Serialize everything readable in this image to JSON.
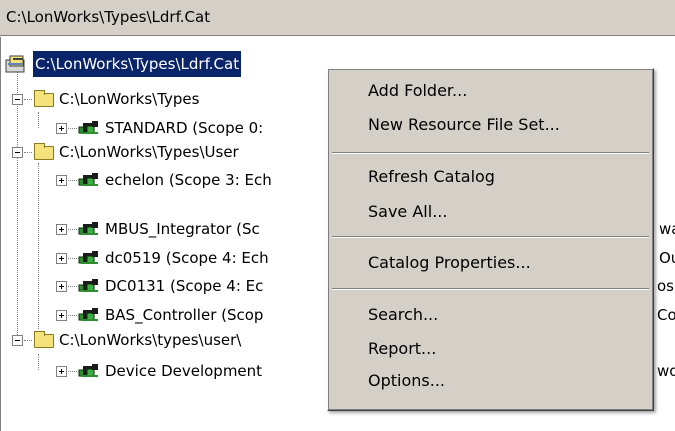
{
  "window": {
    "title": "C:\\LonWorks\\Types\\Ldrf.Cat"
  },
  "tree": {
    "root_label": "C:\\LonWorks\\Types\\Ldrf.Cat",
    "nodes": [
      {
        "label": "C:\\LonWorks\\Types"
      },
      {
        "label": "STANDARD (Scope 0:"
      },
      {
        "label": "C:\\LonWorks\\Types\\User"
      },
      {
        "label": "echelon (Scope 3: Ech"
      },
      {
        "label": "MBUS_Integrator (Sc"
      },
      {
        "label": "dc0519 (Scope 4: Ech"
      },
      {
        "label": "DC0131 (Scope 4: Ec"
      },
      {
        "label": "BAS_Controller (Scop"
      },
      {
        "label": "C:\\LonWorks\\types\\user\\"
      },
      {
        "label": "Device Development"
      }
    ],
    "clipped_right": [
      "wa",
      "Ou",
      "osh",
      "Co",
      "wor"
    ]
  },
  "context_menu": {
    "add_folder": "Add Folder...",
    "new_resource_file_set": "New Resource File Set...",
    "refresh_catalog": "Refresh Catalog",
    "save_all": "Save All...",
    "catalog_properties": "Catalog Properties...",
    "search": "Search...",
    "report": "Report...",
    "options": "Options..."
  },
  "colors": {
    "selection": "#0a246a",
    "menu_bg": "#d4d0c8",
    "folder": "#f4e37a"
  }
}
